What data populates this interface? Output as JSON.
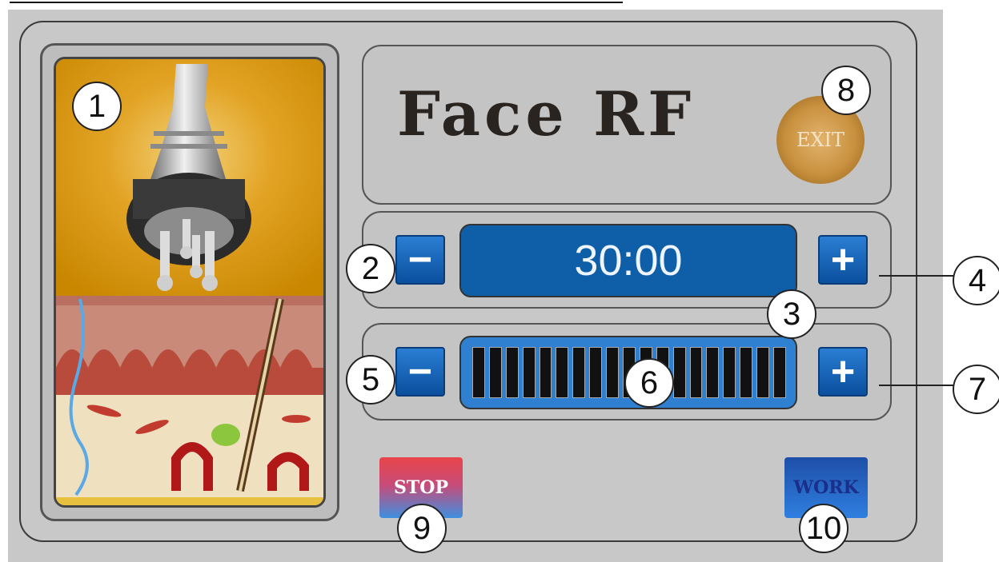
{
  "title": "Face RF",
  "exit_label": "EXIT",
  "timer": {
    "value": "30:00",
    "minus_symbol": "−",
    "plus_symbol": "+"
  },
  "level": {
    "bar_count": 19,
    "minus_symbol": "−",
    "plus_symbol": "+"
  },
  "buttons": {
    "stop": "STOP",
    "work": "WORK"
  },
  "callouts": [
    "1",
    "2",
    "3",
    "4",
    "5",
    "6",
    "7",
    "8",
    "9",
    "10"
  ],
  "icons": {
    "probe": "rf-probe-handpiece-icon",
    "skin": "skin-cross-section-illustration"
  },
  "colors": {
    "panel": "#c8c8c8",
    "blue_button": "#1462b8",
    "display_blue": "#0f5ea8",
    "exit_gold": "#c9913f",
    "stop_red": "#e8454a"
  }
}
